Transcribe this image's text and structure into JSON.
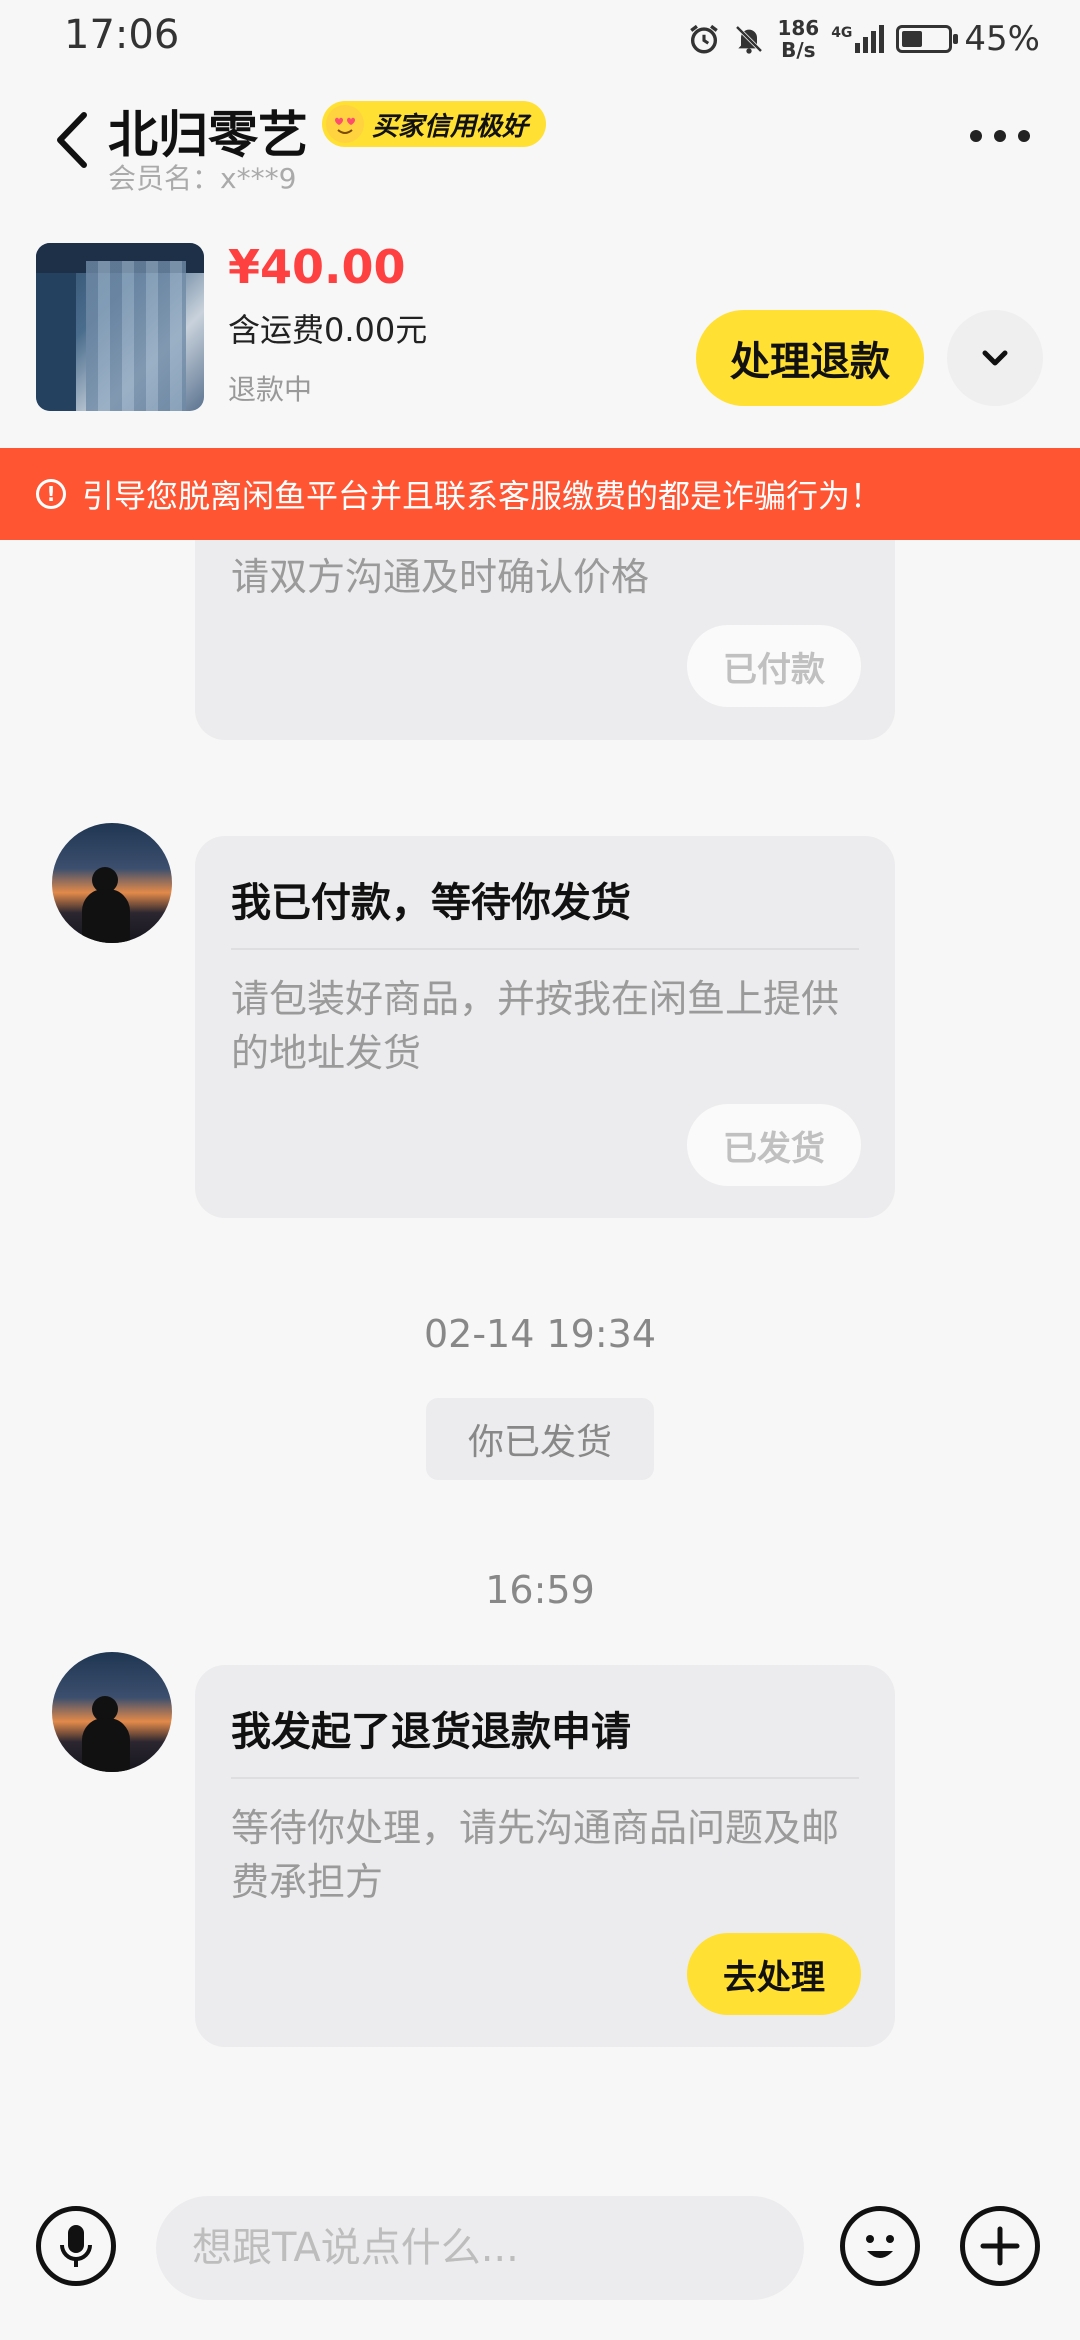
{
  "status_bar": {
    "time": "17:06",
    "net_speed_top": "186",
    "net_speed_bottom": "B/s",
    "network": "4G",
    "battery": "45%",
    "battery_level": 0.45
  },
  "header": {
    "title": "北归零艺",
    "badge": "买家信用极好",
    "member_label": "会员名：x***9"
  },
  "product": {
    "price": "¥40.00",
    "shipping": "含运费0.00元",
    "status": "退款中",
    "action": "处理退款"
  },
  "warning": "引导您脱离闲鱼平台并且联系客服缴费的都是诈骗行为！",
  "messages": [
    {
      "title": "",
      "body": "请双方沟通及时确认价格",
      "button": "已付款"
    },
    {
      "title": "我已付款，等待你发货",
      "body": "请包装好商品，并按我在闲鱼上提供的地址发货",
      "button": "已发货"
    },
    {
      "title": "我发起了退货退款申请",
      "body": "等待你处理，请先沟通商品问题及邮费承担方",
      "button": "去处理"
    }
  ],
  "timestamps": [
    "02-14 19:34",
    "16:59"
  ],
  "system_message": "你已发货",
  "input": {
    "placeholder": "想跟TA说点什么..."
  },
  "colors": {
    "accent_yellow": "#ffe033",
    "price_red": "#ff4040",
    "warning_orange": "#ff5533"
  }
}
